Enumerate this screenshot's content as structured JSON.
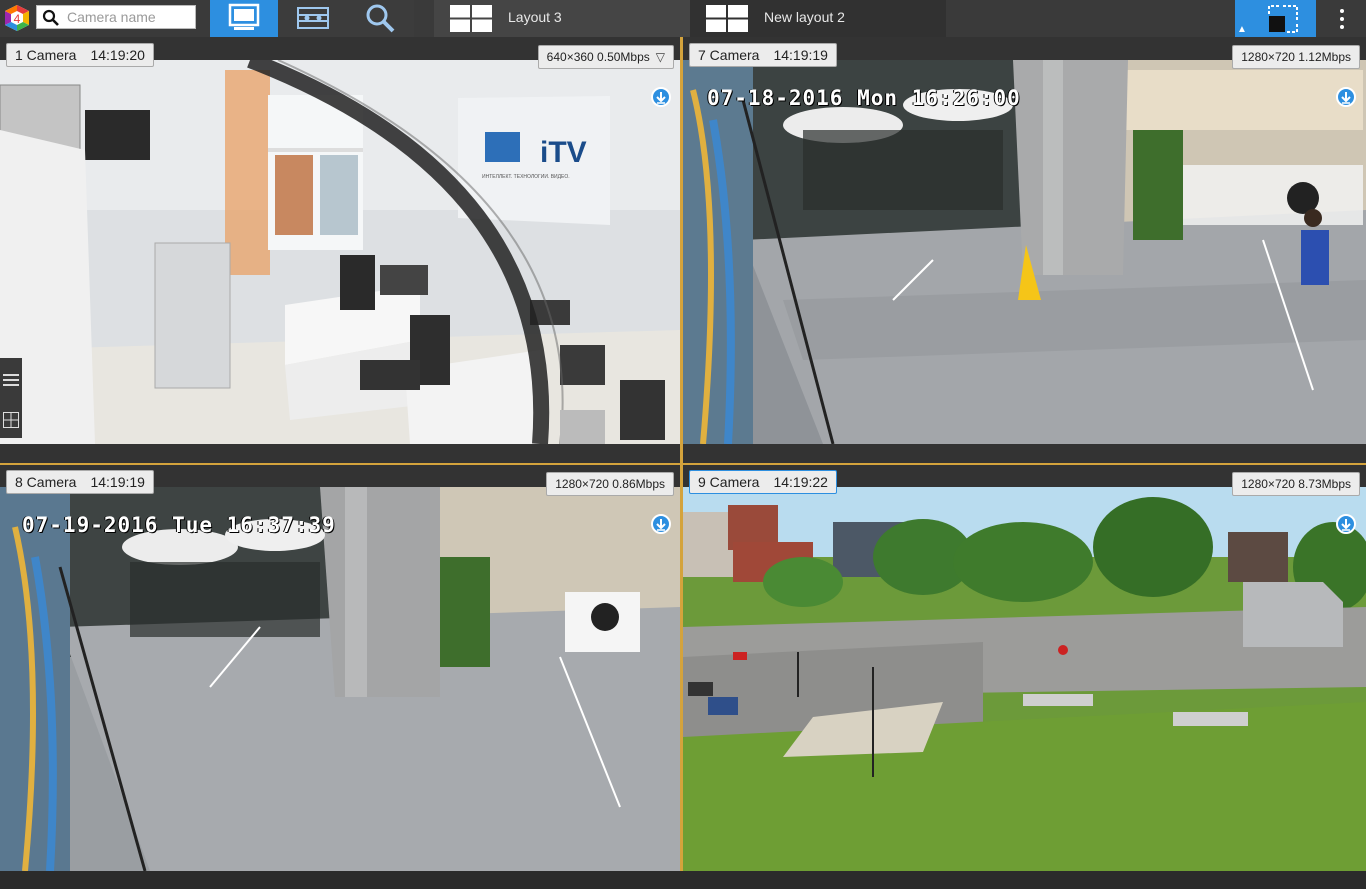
{
  "toolbar": {
    "search_placeholder": "Camera name",
    "tools": [
      "monitor-icon",
      "archive-icon",
      "search-icon"
    ],
    "accent_color": "#2d8fe0"
  },
  "layouts": [
    {
      "label": "Layout 3"
    },
    {
      "label": "New layout 2"
    }
  ],
  "cameras": [
    {
      "name": "1 Camera",
      "time": "14:19:20",
      "resolution": "640×360 0.50Mbps",
      "has_dropdown": true
    },
    {
      "name": "7 Camera",
      "time": "14:19:19",
      "resolution": "1280×720 1.12Mbps",
      "osd": "07-18-2016 Mon 16:26:00"
    },
    {
      "name": "8 Camera",
      "time": "14:19:19",
      "resolution": "1280×720 0.86Mbps",
      "osd": "07-19-2016 Tue 16:37:39"
    },
    {
      "name": "9 Camera",
      "time": "14:19:22",
      "resolution": "1280×720 8.73Mbps",
      "selected": true
    }
  ],
  "scene_text": {
    "banner_logo": "iTV",
    "banner_caption": "ИНТЕЛЛЕКТ. ТЕХНОЛОГИИ. ВИДЕО."
  },
  "side_panel": [
    "list-icon",
    "grid-icon"
  ]
}
